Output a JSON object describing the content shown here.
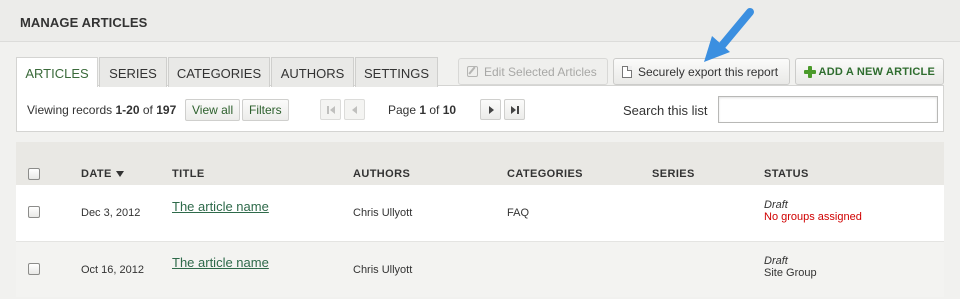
{
  "header": {
    "title": "MANAGE ARTICLES"
  },
  "tabs": [
    {
      "label": "ARTICLES",
      "active": true
    },
    {
      "label": "SERIES"
    },
    {
      "label": "CATEGORIES"
    },
    {
      "label": "AUTHORS"
    },
    {
      "label": "SETTINGS"
    }
  ],
  "toolbar": {
    "edit_selected_label": "Edit Selected Articles",
    "export_label": "Securely export this report",
    "add_article_label": "ADD A NEW ARTICLE"
  },
  "records": {
    "prefix": "Viewing records ",
    "range": "1-20",
    "of": " of ",
    "total": "197",
    "view_all_label": "View all",
    "filters_label": "Filters"
  },
  "pager": {
    "prefix": "Page ",
    "current": "1",
    "of": " of ",
    "total": "10"
  },
  "search": {
    "label": "Search this list",
    "value": "",
    "placeholder": ""
  },
  "table": {
    "columns": [
      "DATE",
      "TITLE",
      "AUTHORS",
      "CATEGORIES",
      "SERIES",
      "STATUS"
    ],
    "rows": [
      {
        "date": "Dec 3, 2012",
        "title": "The article name",
        "authors": "Chris Ullyott",
        "categories": "FAQ",
        "series": "",
        "status": "Draft",
        "status_note": "No groups assigned"
      },
      {
        "date": "Oct 16, 2012",
        "title": "The article name",
        "authors": "Chris Ullyott",
        "categories": "",
        "series": "",
        "status": "Draft",
        "status_note": "Site Group"
      }
    ]
  },
  "colors": {
    "accent_green": "#2f6d2f",
    "link": "#2e6a4a",
    "warning": "#d00000",
    "callout_arrow": "#3b8fe0"
  }
}
